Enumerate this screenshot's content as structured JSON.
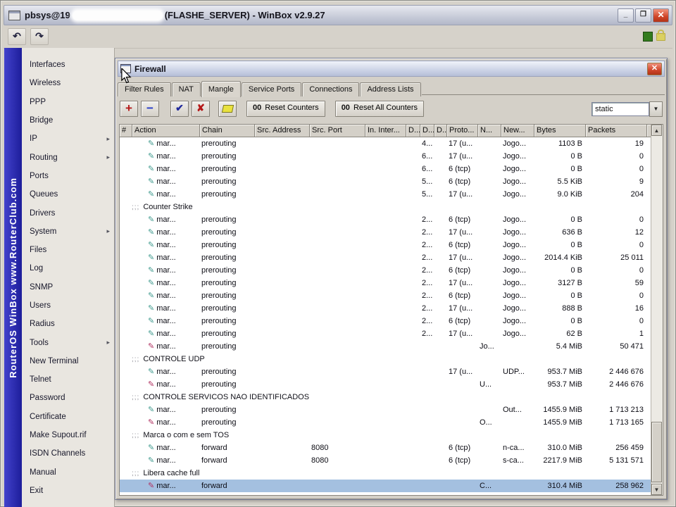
{
  "titlebar": {
    "title_left": "pbsys@19",
    "title_right": "(FLASHE_SERVER) - WinBox v2.9.27",
    "minimize_label": "_",
    "maximize_label": "❐",
    "close_label": "✕"
  },
  "app_toolbar": {
    "undo_icon": "↶",
    "redo_icon": "↷"
  },
  "banner": {
    "line": "RouterOS WinBox   www.RouterClub.com"
  },
  "sidebar": {
    "items": [
      {
        "label": "Interfaces",
        "submenu": false
      },
      {
        "label": "Wireless",
        "submenu": false
      },
      {
        "label": "PPP",
        "submenu": false
      },
      {
        "label": "Bridge",
        "submenu": false
      },
      {
        "label": "IP",
        "submenu": true
      },
      {
        "label": "Routing",
        "submenu": true
      },
      {
        "label": "Ports",
        "submenu": false
      },
      {
        "label": "Queues",
        "submenu": false
      },
      {
        "label": "Drivers",
        "submenu": false
      },
      {
        "label": "System",
        "submenu": true
      },
      {
        "label": "Files",
        "submenu": false
      },
      {
        "label": "Log",
        "submenu": false
      },
      {
        "label": "SNMP",
        "submenu": false
      },
      {
        "label": "Users",
        "submenu": false
      },
      {
        "label": "Radius",
        "submenu": false
      },
      {
        "label": "Tools",
        "submenu": true
      },
      {
        "label": "New Terminal",
        "submenu": false
      },
      {
        "label": "Telnet",
        "submenu": false
      },
      {
        "label": "Password",
        "submenu": false
      },
      {
        "label": "Certificate",
        "submenu": false
      },
      {
        "label": "Make Supout.rif",
        "submenu": false
      },
      {
        "label": "ISDN Channels",
        "submenu": false
      },
      {
        "label": "Manual",
        "submenu": false
      },
      {
        "label": "Exit",
        "submenu": false
      }
    ]
  },
  "firewall": {
    "title": "Firewall",
    "close_label": "✕",
    "tabs": [
      {
        "label": "Filter Rules",
        "active": false
      },
      {
        "label": "NAT",
        "active": false
      },
      {
        "label": "Mangle",
        "active": true
      },
      {
        "label": "Service Ports",
        "active": false
      },
      {
        "label": "Connections",
        "active": false
      },
      {
        "label": "Address Lists",
        "active": false
      }
    ],
    "toolbar": {
      "add_icon": "+",
      "remove_icon": "−",
      "enable_icon": "✔",
      "disable_icon": "✘",
      "counter_prefix": "00",
      "reset_counters": "Reset Counters",
      "reset_all_counters": "Reset All Counters",
      "filter_value": "static",
      "dropdown_arrow": "▼"
    },
    "columns": [
      "#",
      "Action",
      "Chain",
      "Src. Address",
      "Src. Port",
      "In. Inter...",
      "D...",
      "D...",
      "D...",
      "Proto...",
      "N...",
      "New...",
      "Bytes",
      "Packets"
    ],
    "scrollbar": {
      "up_icon": "▲",
      "down_icon": "▼"
    },
    "rows": [
      {
        "type": "rule",
        "icon": "teal",
        "action": "mar...",
        "chain": "prerouting",
        "src_port": "",
        "d": "4...",
        "proto": "17 (u...",
        "n": "",
        "new": "Jogo...",
        "bytes": "1103 B",
        "packets": "19",
        "selected": false
      },
      {
        "type": "rule",
        "icon": "teal",
        "action": "mar...",
        "chain": "prerouting",
        "src_port": "",
        "d": "6...",
        "proto": "17 (u...",
        "n": "",
        "new": "Jogo...",
        "bytes": "0 B",
        "packets": "0",
        "selected": false
      },
      {
        "type": "rule",
        "icon": "teal",
        "action": "mar...",
        "chain": "prerouting",
        "src_port": "",
        "d": "6...",
        "proto": "6 (tcp)",
        "n": "",
        "new": "Jogo...",
        "bytes": "0 B",
        "packets": "0",
        "selected": false
      },
      {
        "type": "rule",
        "icon": "teal",
        "action": "mar...",
        "chain": "prerouting",
        "src_port": "",
        "d": "5...",
        "proto": "6 (tcp)",
        "n": "",
        "new": "Jogo...",
        "bytes": "5.5 KiB",
        "packets": "9",
        "selected": false
      },
      {
        "type": "rule",
        "icon": "teal",
        "action": "mar...",
        "chain": "prerouting",
        "src_port": "",
        "d": "5...",
        "proto": "17 (u...",
        "n": "",
        "new": "Jogo...",
        "bytes": "9.0 KiB",
        "packets": "204",
        "selected": false
      },
      {
        "type": "comment",
        "label": "Counter Strike"
      },
      {
        "type": "rule",
        "icon": "teal",
        "action": "mar...",
        "chain": "prerouting",
        "src_port": "",
        "d": "2...",
        "proto": "6 (tcp)",
        "n": "",
        "new": "Jogo...",
        "bytes": "0 B",
        "packets": "0",
        "selected": false
      },
      {
        "type": "rule",
        "icon": "teal",
        "action": "mar...",
        "chain": "prerouting",
        "src_port": "",
        "d": "2...",
        "proto": "17 (u...",
        "n": "",
        "new": "Jogo...",
        "bytes": "636 B",
        "packets": "12",
        "selected": false
      },
      {
        "type": "rule",
        "icon": "teal",
        "action": "mar...",
        "chain": "prerouting",
        "src_port": "",
        "d": "2...",
        "proto": "6 (tcp)",
        "n": "",
        "new": "Jogo...",
        "bytes": "0 B",
        "packets": "0",
        "selected": false
      },
      {
        "type": "rule",
        "icon": "teal",
        "action": "mar...",
        "chain": "prerouting",
        "src_port": "",
        "d": "2...",
        "proto": "17 (u...",
        "n": "",
        "new": "Jogo...",
        "bytes": "2014.4 KiB",
        "packets": "25 011",
        "selected": false
      },
      {
        "type": "rule",
        "icon": "teal",
        "action": "mar...",
        "chain": "prerouting",
        "src_port": "",
        "d": "2...",
        "proto": "6 (tcp)",
        "n": "",
        "new": "Jogo...",
        "bytes": "0 B",
        "packets": "0",
        "selected": false
      },
      {
        "type": "rule",
        "icon": "teal",
        "action": "mar...",
        "chain": "prerouting",
        "src_port": "",
        "d": "2...",
        "proto": "17 (u...",
        "n": "",
        "new": "Jogo...",
        "bytes": "3127 B",
        "packets": "59",
        "selected": false
      },
      {
        "type": "rule",
        "icon": "teal",
        "action": "mar...",
        "chain": "prerouting",
        "src_port": "",
        "d": "2...",
        "proto": "6 (tcp)",
        "n": "",
        "new": "Jogo...",
        "bytes": "0 B",
        "packets": "0",
        "selected": false
      },
      {
        "type": "rule",
        "icon": "teal",
        "action": "mar...",
        "chain": "prerouting",
        "src_port": "",
        "d": "2...",
        "proto": "17 (u...",
        "n": "",
        "new": "Jogo...",
        "bytes": "888 B",
        "packets": "16",
        "selected": false
      },
      {
        "type": "rule",
        "icon": "teal",
        "action": "mar...",
        "chain": "prerouting",
        "src_port": "",
        "d": "2...",
        "proto": "6 (tcp)",
        "n": "",
        "new": "Jogo...",
        "bytes": "0 B",
        "packets": "0",
        "selected": false
      },
      {
        "type": "rule",
        "icon": "teal",
        "action": "mar...",
        "chain": "prerouting",
        "src_port": "",
        "d": "2...",
        "proto": "17 (u...",
        "n": "",
        "new": "Jogo...",
        "bytes": "62 B",
        "packets": "1",
        "selected": false
      },
      {
        "type": "rule",
        "icon": "red",
        "action": "mar...",
        "chain": "prerouting",
        "src_port": "",
        "d": "",
        "proto": "",
        "n": "Jo...",
        "new": "",
        "bytes": "5.4 MiB",
        "packets": "50 471",
        "selected": false
      },
      {
        "type": "comment",
        "label": "CONTROLE UDP"
      },
      {
        "type": "rule",
        "icon": "teal",
        "action": "mar...",
        "chain": "prerouting",
        "src_port": "",
        "d": "",
        "proto": "17 (u...",
        "n": "",
        "new": "UDP...",
        "bytes": "953.7 MiB",
        "packets": "2 446 676",
        "selected": false
      },
      {
        "type": "rule",
        "icon": "red",
        "action": "mar...",
        "chain": "prerouting",
        "src_port": "",
        "d": "",
        "proto": "",
        "n": "U...",
        "new": "",
        "bytes": "953.7 MiB",
        "packets": "2 446 676",
        "selected": false
      },
      {
        "type": "comment",
        "label": "CONTROLE SERVICOS NAO IDENTIFICADOS"
      },
      {
        "type": "rule",
        "icon": "teal",
        "action": "mar...",
        "chain": "prerouting",
        "src_port": "",
        "d": "",
        "proto": "",
        "n": "",
        "new": "Out...",
        "bytes": "1455.9 MiB",
        "packets": "1 713 213",
        "selected": false
      },
      {
        "type": "rule",
        "icon": "red",
        "action": "mar...",
        "chain": "prerouting",
        "src_port": "",
        "d": "",
        "proto": "",
        "n": "O...",
        "new": "",
        "bytes": "1455.9 MiB",
        "packets": "1 713 165",
        "selected": false
      },
      {
        "type": "comment",
        "label": "Marca o com e sem TOS"
      },
      {
        "type": "rule",
        "icon": "teal",
        "action": "mar...",
        "chain": "forward",
        "src_port": "8080",
        "d": "",
        "proto": "6 (tcp)",
        "n": "",
        "new": "n-ca...",
        "bytes": "310.0 MiB",
        "packets": "256 459",
        "selected": false
      },
      {
        "type": "rule",
        "icon": "teal",
        "action": "mar...",
        "chain": "forward",
        "src_port": "8080",
        "d": "",
        "proto": "6 (tcp)",
        "n": "",
        "new": "s-ca...",
        "bytes": "2217.9 MiB",
        "packets": "5 131 571",
        "selected": false
      },
      {
        "type": "comment",
        "label": "Libera cache full"
      },
      {
        "type": "rule",
        "icon": "red",
        "action": "mar...",
        "chain": "forward",
        "src_port": "",
        "d": "",
        "proto": "",
        "n": "C...",
        "new": "",
        "bytes": "310.4 MiB",
        "packets": "258 962",
        "selected": true
      }
    ]
  }
}
